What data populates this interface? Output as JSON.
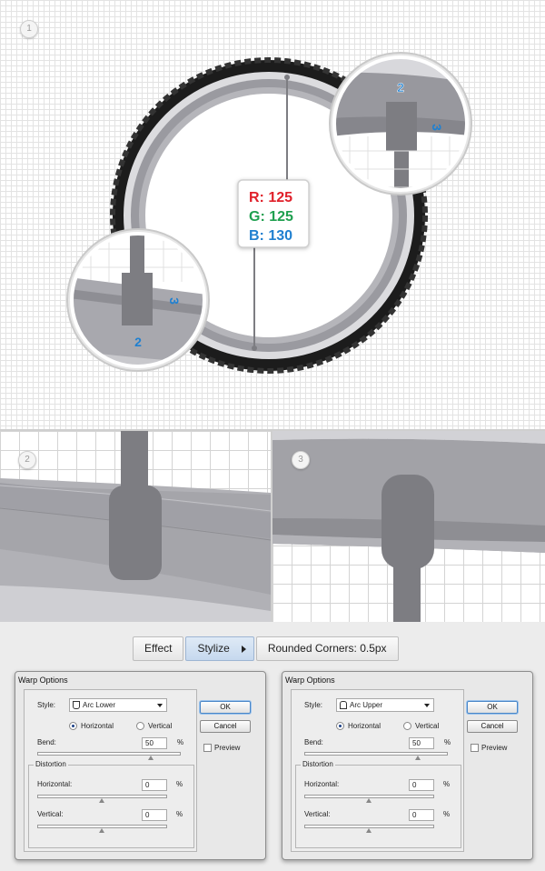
{
  "steps": {
    "step1": "1",
    "step2": "2",
    "step3": "3"
  },
  "color_label": {
    "r": "R: 125",
    "g": "G: 125",
    "b": "B: 130"
  },
  "magnifier_labels": {
    "top_width": "2",
    "top_height": "3",
    "bottom_width": "2",
    "bottom_height": "3"
  },
  "colors": {
    "red": "#e0202a",
    "green": "#20a050",
    "blue": "#2080d0",
    "hub_gray": "#7d7d82"
  },
  "menu": {
    "effect": "Effect",
    "stylize": "Stylize",
    "rounded": "Rounded Corners: 0.5px"
  },
  "dialog_left": {
    "title": "Warp Options",
    "style_label": "Style:",
    "style_value": "Arc Lower",
    "horizontal": "Horizontal",
    "vertical": "Vertical",
    "bend_label": "Bend:",
    "bend_value": "50",
    "pct": "%",
    "distortion": "Distortion",
    "dist_h_label": "Horizontal:",
    "dist_h_value": "0",
    "dist_v_label": "Vertical:",
    "dist_v_value": "0",
    "ok": "OK",
    "cancel": "Cancel",
    "preview": "Preview"
  },
  "dialog_right": {
    "title": "Warp Options",
    "style_label": "Style:",
    "style_value": "Arc Upper",
    "horizontal": "Horizontal",
    "vertical": "Vertical",
    "bend_label": "Bend:",
    "bend_value": "50",
    "pct": "%",
    "distortion": "Distortion",
    "dist_h_label": "Horizontal:",
    "dist_h_value": "0",
    "dist_v_label": "Vertical:",
    "dist_v_value": "0",
    "ok": "OK",
    "cancel": "Cancel",
    "preview": "Preview"
  }
}
